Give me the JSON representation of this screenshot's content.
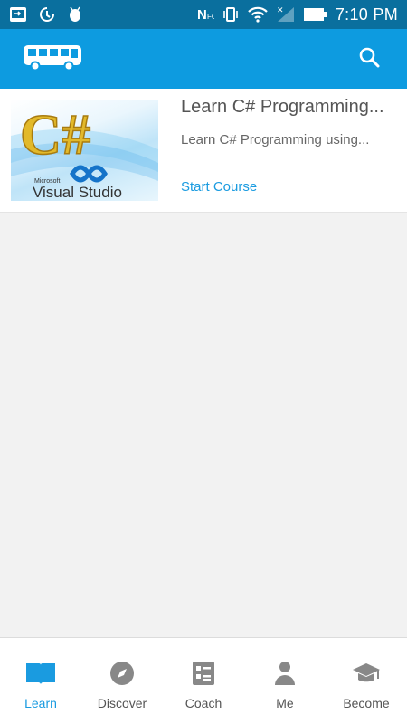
{
  "status_bar": {
    "time": "7:10 PM",
    "nfc_label": "N",
    "icons": [
      "screen-share-icon",
      "sync-icon",
      "android-debug-icon",
      "nfc-icon",
      "vibrate-icon",
      "wifi-icon",
      "signal-icon",
      "battery-icon"
    ]
  },
  "app_bar": {
    "logo_icon": "bus-icon",
    "search_icon": "search-icon",
    "colors": {
      "background": "#0d9be0",
      "status": "#0a6f9e"
    }
  },
  "course": {
    "title": "Learn C# Programming...",
    "description": "Learn C# Programming using...",
    "action": "Start Course",
    "thumbnail": {
      "logo_text": "C#",
      "brand_small": "Microsoft",
      "brand": "Visual Studio"
    }
  },
  "bottom_nav": {
    "accent": "#1a9be0",
    "items": [
      {
        "label": "Learn",
        "icon": "book-icon",
        "active": true
      },
      {
        "label": "Discover",
        "icon": "compass-icon",
        "active": false
      },
      {
        "label": "Coach",
        "icon": "clipboard-icon",
        "active": false
      },
      {
        "label": "Me",
        "icon": "person-icon",
        "active": false
      },
      {
        "label": "Become",
        "icon": "graduation-cap-icon",
        "active": false
      }
    ]
  }
}
